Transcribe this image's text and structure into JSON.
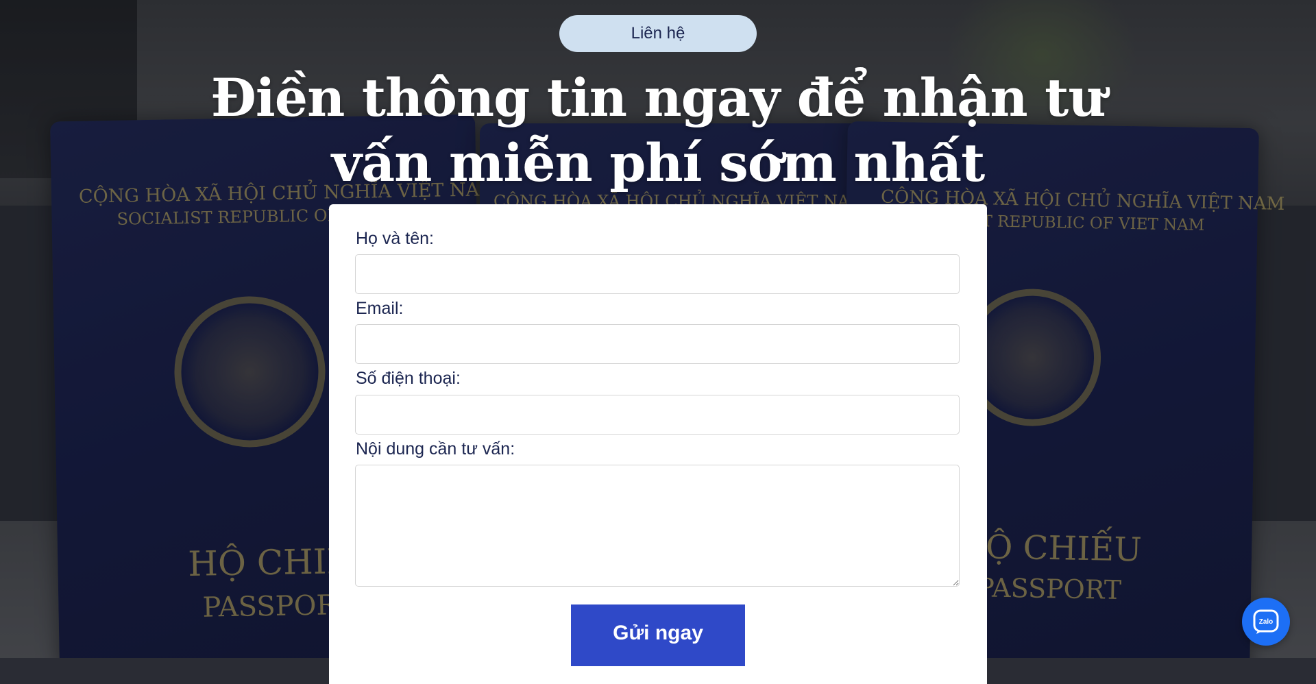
{
  "section": {
    "pill_label": "Liên hệ",
    "headline_line1": "Điền thông tin ngay để nhận tư",
    "headline_line2": "vấn miễn phí sớm nhất"
  },
  "background": {
    "passport_top_text_1": "CỘNG HÒA XÃ HỘI CHỦ NGHĨA VIỆT NAM",
    "passport_top_text_2": "SOCIALIST REPUBLIC OF VIET NAM",
    "passport_title_1": "HỘ CHIẾU",
    "passport_title_2": "PASSPORT"
  },
  "form": {
    "name_label": "Họ và tên:",
    "name_value": "",
    "email_label": "Email:",
    "email_value": "",
    "phone_label": "Số điện thoại:",
    "phone_value": "",
    "message_label": "Nội dung cần tư vấn:",
    "message_value": "",
    "submit_label": "Gửi ngay"
  },
  "floating": {
    "zalo_label": "Zalo",
    "zalo_icon": "zalo-chat-icon"
  },
  "colors": {
    "accent": "#2f49c8",
    "pill_bg": "#cfe0f0",
    "label_text": "#1b2550",
    "zalo": "#1d6ff5"
  }
}
